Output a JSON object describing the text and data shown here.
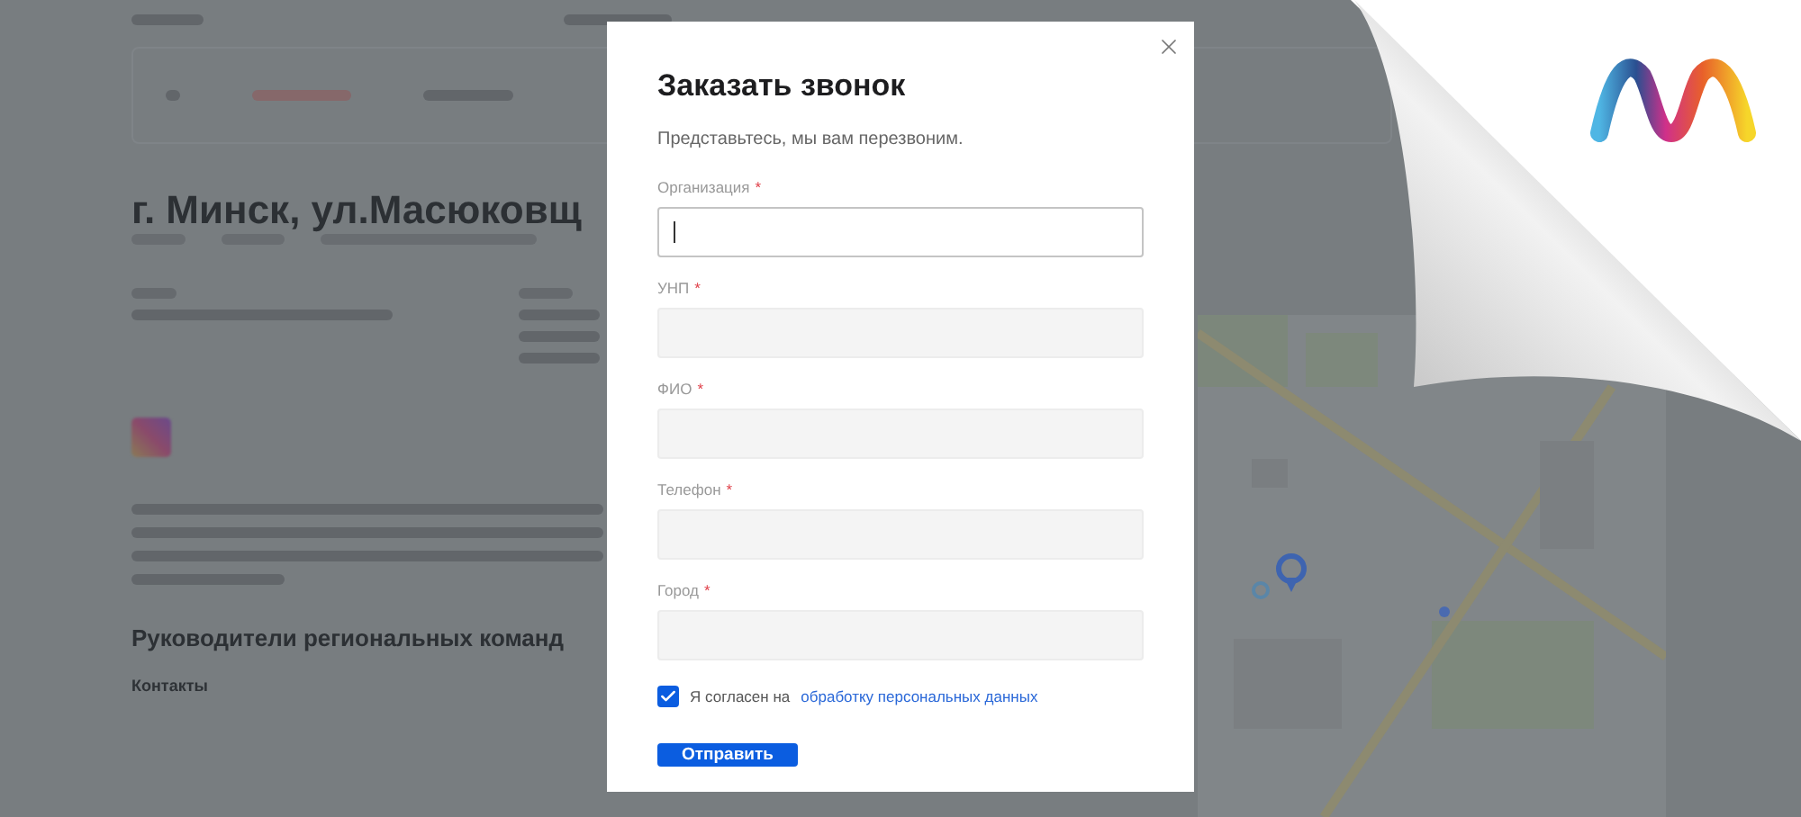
{
  "page": {
    "heading": "г. Минск, ул.Масюковщ",
    "section_title": "Руководители региональных команд",
    "section_subtitle": "Контакты"
  },
  "dialog": {
    "title": "Заказать звонок",
    "subtitle": "Представьтесь, мы вам перезвоним.",
    "fields": [
      {
        "label": "Организация",
        "mark": "*",
        "focused": true
      },
      {
        "label": "УНП",
        "mark": "*",
        "focused": false
      },
      {
        "label": "ФИО",
        "mark": "*",
        "focused": false
      },
      {
        "label": "Телефон",
        "mark": "*",
        "focused": false
      },
      {
        "label": "Город",
        "mark": "*",
        "focused": false
      }
    ],
    "consent": {
      "checked": true,
      "text": "Я согласен на",
      "link": "обработку персональных данных"
    },
    "submit": "Отправить"
  }
}
